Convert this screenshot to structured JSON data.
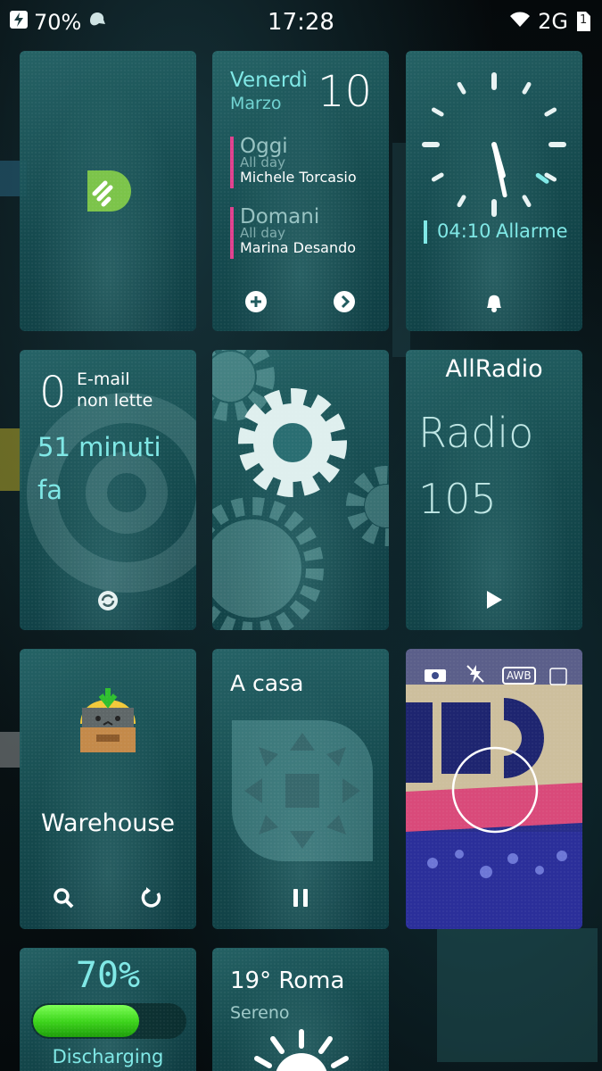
{
  "status_bar": {
    "battery_percent": "70%",
    "time": "17:28",
    "network": "2G",
    "sim_slot": "1",
    "icons": [
      "charging-bolt-icon",
      "notification-icon",
      "wifi-icon",
      "sim-icon"
    ]
  },
  "tiles": {
    "feedly": {
      "icon": "feedly-logo"
    },
    "calendar": {
      "weekday": "Venerdì",
      "month": "Marzo",
      "day": "10",
      "events": [
        {
          "day_label": "Oggi",
          "time_label": "All day",
          "title": "Michele Torcasio"
        },
        {
          "day_label": "Domani",
          "time_label": "All day",
          "title": "Marina Desando"
        }
      ],
      "icons": [
        "add-icon",
        "next-icon"
      ]
    },
    "clock": {
      "alarm_time": "04:10",
      "alarm_label": "Allarme",
      "icon": "alarm-bell-icon",
      "accent": "#7fe8e6"
    },
    "email": {
      "count": "0",
      "label_line1": "E-mail",
      "label_line2": "non lette",
      "sync_line1": "51 minuti",
      "sync_line2": "fa",
      "icon": "refresh-sync-icon"
    },
    "settings": {
      "icon": "gears-icon"
    },
    "radio": {
      "app_name": "AllRadio",
      "station_line1": "Radio",
      "station_line2": "105",
      "icon": "play-icon"
    },
    "warehouse": {
      "app_name": "Warehouse",
      "icons": [
        "search-icon",
        "refresh-icon"
      ]
    },
    "location": {
      "profile": "A casa",
      "icon": "pause-icon"
    },
    "camera": {
      "badges": [
        "AWB"
      ],
      "icons": [
        "camera-icon",
        "flash-off-icon",
        "iso-icon",
        "shutter-icon"
      ]
    },
    "battery": {
      "percent": "70%",
      "level": 0.7,
      "status": "Discharging",
      "bar_color": "#3ed61d"
    },
    "weather": {
      "temperature": "19°",
      "city": "Roma",
      "condition": "Sereno",
      "icon": "sun-icon"
    }
  }
}
